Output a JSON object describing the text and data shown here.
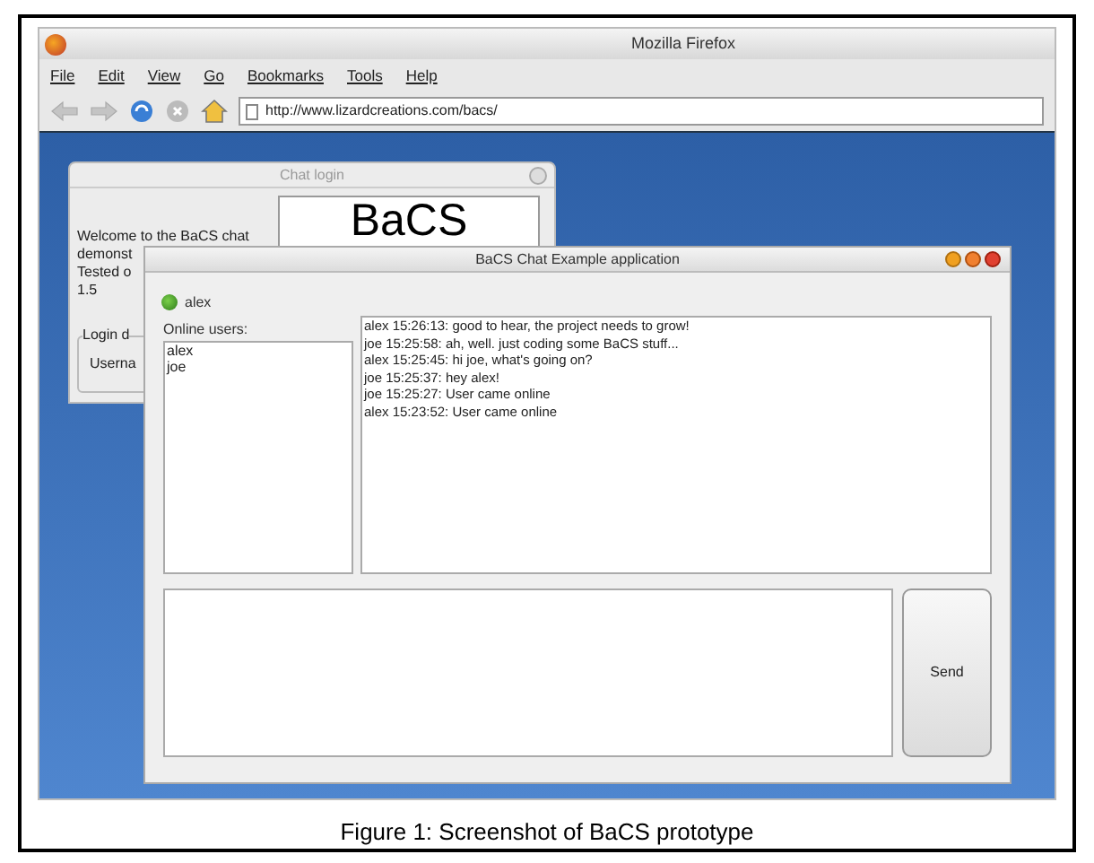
{
  "browser": {
    "title": "Mozilla Firefox",
    "menu": [
      "File",
      "Edit",
      "View",
      "Go",
      "Bookmarks",
      "Tools",
      "Help"
    ],
    "url": "http://www.lizardcreations.com/bacs/"
  },
  "login_window": {
    "title": "Chat login",
    "intro": [
      "Welcome to the BaCS chat",
      "demonst",
      "Tested o",
      "1.5"
    ],
    "logo": "BaCS",
    "group_label": "Login d",
    "username_label": "Userna"
  },
  "chat_window": {
    "title": "BaCS Chat Example application",
    "user": "alex",
    "online_label": "Online users:",
    "users": [
      "alex",
      "joe"
    ],
    "messages": [
      "alex 15:26:13: good to hear, the project needs to grow!",
      "joe 15:25:58: ah, well. just coding some BaCS stuff...",
      "alex 15:25:45: hi joe, what's going on?",
      "joe 15:25:37: hey alex!",
      "joe 15:25:27: User came online",
      "alex 15:23:52: User came online"
    ],
    "send": "Send"
  },
  "caption": "Figure 1: Screenshot of BaCS prototype"
}
